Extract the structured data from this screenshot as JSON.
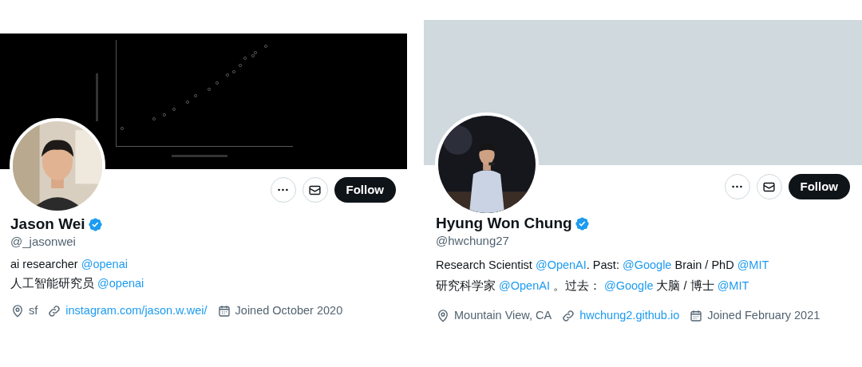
{
  "profiles": [
    {
      "banner": {
        "kind": "picture"
      },
      "avatar": {
        "kind": "picture"
      },
      "buttons": {
        "follow": "Follow"
      },
      "name": "Jason Wei",
      "verified": true,
      "handle": "@_jasonwei",
      "bio": [
        [
          {
            "kind": "text",
            "text": "ai researcher "
          },
          {
            "kind": "mention",
            "text": "@openai"
          }
        ],
        [
          {
            "kind": "text",
            "text": "人工智能研究员 "
          },
          {
            "kind": "mention",
            "text": "@openai"
          }
        ]
      ],
      "meta": [
        {
          "kind": "location",
          "text": "sf"
        },
        {
          "kind": "link",
          "text": "instagram.com/jason.w.wei/"
        },
        {
          "kind": "joined",
          "text": "Joined October 2020"
        }
      ]
    },
    {
      "banner": {
        "kind": "plain",
        "color": "#cfd9de"
      },
      "avatar": {
        "kind": "picture"
      },
      "buttons": {
        "follow": "Follow"
      },
      "name": "Hyung Won Chung",
      "verified": true,
      "handle": "@hwchung27",
      "bio": [
        [
          {
            "kind": "text",
            "text": "Research Scientist "
          },
          {
            "kind": "mention",
            "text": "@OpenAI"
          },
          {
            "kind": "text",
            "text": ". Past: "
          },
          {
            "kind": "mention",
            "text": "@Google"
          },
          {
            "kind": "text",
            "text": " Brain / PhD "
          },
          {
            "kind": "mention",
            "text": "@MIT"
          }
        ],
        [
          {
            "kind": "text",
            "text": "研究科学家 "
          },
          {
            "kind": "mention",
            "text": "@OpenAI"
          },
          {
            "kind": "text",
            "text": " 。过去： "
          },
          {
            "kind": "mention",
            "text": "@Google"
          },
          {
            "kind": "text",
            "text": " 大脑 / 博士 "
          },
          {
            "kind": "mention",
            "text": "@MIT"
          }
        ]
      ],
      "meta": [
        {
          "kind": "location",
          "text": "Mountain View, CA"
        },
        {
          "kind": "link",
          "text": "hwchung2.github.io"
        },
        {
          "kind": "joined",
          "text": "Joined February 2021"
        }
      ]
    }
  ]
}
